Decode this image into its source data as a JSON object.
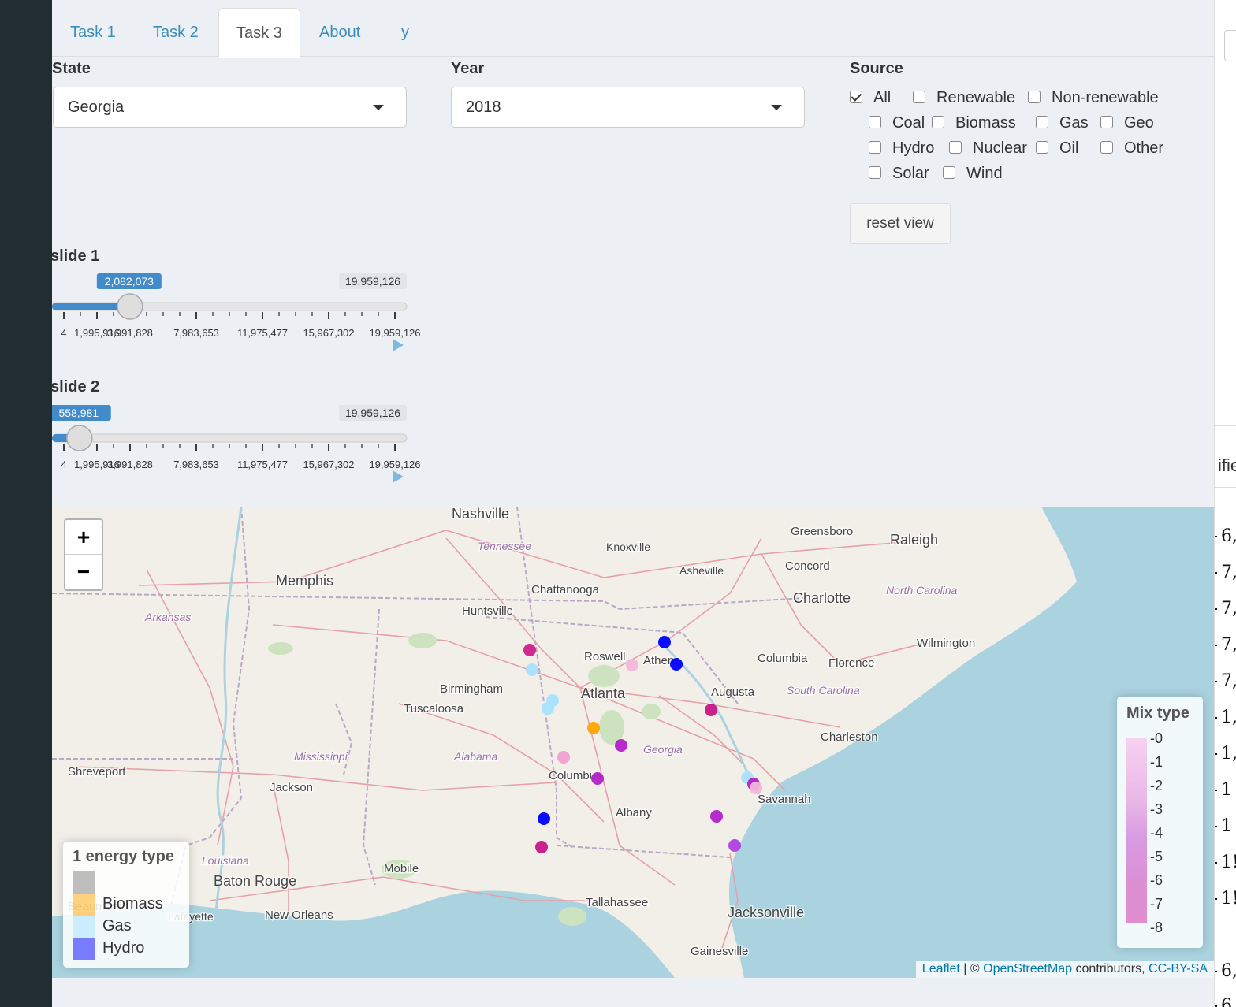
{
  "tabs": [
    {
      "label": "Task 1"
    },
    {
      "label": "Task 2"
    },
    {
      "label": "Task 3"
    },
    {
      "label": "About"
    },
    {
      "label": "y"
    }
  ],
  "controls": {
    "state": {
      "label": "State",
      "value": "Georgia"
    },
    "year": {
      "label": "Year",
      "value": "2018"
    },
    "source": {
      "label": "Source",
      "options": [
        {
          "label": "All",
          "checked": true
        },
        {
          "label": "Renewable",
          "checked": false
        },
        {
          "label": "Non-renewable",
          "checked": false
        },
        {
          "label": "Coal",
          "checked": false
        },
        {
          "label": "Biomass",
          "checked": false
        },
        {
          "label": "Gas",
          "checked": false
        },
        {
          "label": "Geo",
          "checked": false
        },
        {
          "label": "Hydro",
          "checked": false
        },
        {
          "label": "Nuclear",
          "checked": false
        },
        {
          "label": "Oil",
          "checked": false
        },
        {
          "label": "Other",
          "checked": false
        },
        {
          "label": "Solar",
          "checked": false
        },
        {
          "label": "Wind",
          "checked": false
        }
      ]
    },
    "reset_label": "reset view"
  },
  "sliders": [
    {
      "label": "slide 1",
      "from_label": "2,082,073",
      "to_label": "19,959,126",
      "min": 4,
      "max": 19959126,
      "value": 2082073,
      "tick_labels": [
        "4",
        "1,995,916",
        "3,991,828",
        "7,983,653",
        "11,975,477",
        "15,967,302",
        "19,959,126"
      ]
    },
    {
      "label": "slide 2",
      "from_label": "558,981",
      "to_label": "19,959,126",
      "min": 4,
      "max": 19959126,
      "value": 558981,
      "tick_labels": [
        "4",
        "1,995,916",
        "3,991,828",
        "7,983,653",
        "11,975,477",
        "15,967,302",
        "19,959,126"
      ]
    }
  ],
  "map": {
    "zoom_in": "+",
    "zoom_out": "−",
    "places": [
      "Nashville",
      "Tennessee",
      "Knoxville",
      "Greensboro",
      "Raleigh",
      "Memphis",
      "Asheville",
      "Concord",
      "Chattanooga",
      "Charlotte",
      "North Carolina",
      "Arkansas",
      "Huntsville",
      "Roswell",
      "Athens",
      "Columbia",
      "Wilmington",
      "Florence",
      "Birmingham",
      "Atlanta",
      "Augusta",
      "South Carolina",
      "Tuscaloosa",
      "Charleston",
      "Georgia",
      "Mississippi",
      "Alabama",
      "Columbus",
      "Shreveport",
      "Jackson",
      "Savannah",
      "Albany",
      "Mobile",
      "Louisiana",
      "Baton Rouge",
      "Tallahassee",
      "New Orleans",
      "Jacksonville",
      "Lafayette",
      "Beaumont",
      "Gainesville"
    ],
    "legend_single": {
      "title": "1 energy type",
      "items": [
        {
          "label": "",
          "color": "#808080"
        },
        {
          "label": "Biomass",
          "color": "#ffa500"
        },
        {
          "label": "Gas",
          "color": "#a6e1ff"
        },
        {
          "label": "Hydro",
          "color": "#0000ff"
        }
      ]
    },
    "legend_mix": {
      "title": "Mix type",
      "ticks": [
        "0",
        "1",
        "2",
        "3",
        "4",
        "5",
        "6",
        "7",
        "8"
      ],
      "color_low": "#f6d2f2",
      "color_high": "#e08ed0"
    },
    "attribution": {
      "leaflet": "Leaflet",
      "sep": " | © ",
      "osm": "OpenStreetMap",
      "contributors": " contributors, ",
      "license": "CC-BY-SA"
    }
  },
  "right_panel": {
    "header_fragment": "ifie",
    "values": [
      "6,",
      "7,",
      "7,",
      "7,",
      "7,",
      "1,",
      "1,",
      "1",
      "1",
      "1!",
      "1!",
      "6,",
      "6"
    ]
  }
}
